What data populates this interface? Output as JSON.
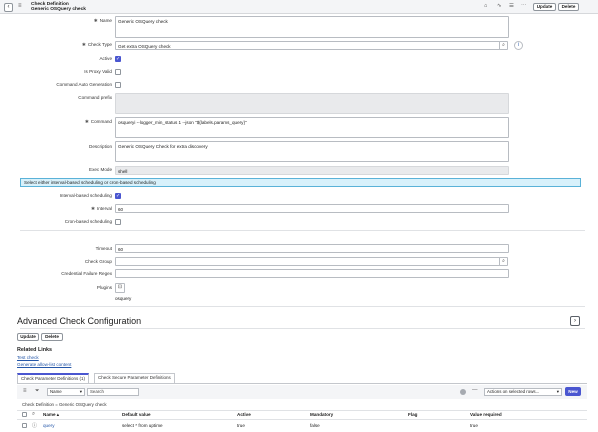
{
  "header": {
    "title_line1": "Check Definition",
    "title_line2": "Generic OSQuery check",
    "back_icon": "chevron-left-icon",
    "menu_icon": "hamburger-icon",
    "update_label": "Update",
    "delete_label": "Delete"
  },
  "form": {
    "name_label": "Name",
    "name_value": "Generic OSQuery check",
    "check_type_label": "Check Type",
    "check_type_value": "Get extra OSQuery check",
    "active_label": "Active",
    "proxy_label": "Is Proxy Valid",
    "auto_gen_label": "Command Auto Generation",
    "prefix_label": "Command prefix",
    "command_label": "Command",
    "command_value": "osqueryi --logger_min_status 1 --json \"${labels.params_query}\"",
    "description_label": "Description",
    "description_value": "Generic OSQuery Check for extra discovery",
    "exec_mode_label": "Exec Mode",
    "exec_mode_value": "shell",
    "info_message": "Select either interval-based scheduling or cron-based scheduling",
    "interval_sched_label": "Interval-based scheduling",
    "interval_label": "Interval",
    "interval_value": "60",
    "cron_label": "Cron-based scheduling",
    "timeout_label": "Timeout",
    "timeout_value": "60",
    "check_group_label": "Check Group",
    "cred_regex_label": "Credential Failure Regex",
    "plugins_label": "Plugins",
    "plugins_value": "osquery"
  },
  "advanced": {
    "title": "Advanced Check Configuration",
    "update_label": "Update",
    "delete_label": "Delete",
    "related_links_title": "Related Links",
    "link_test": "Test check",
    "link_allow": "Generate allow-list content"
  },
  "tabs": [
    {
      "label": "Check Parameter Definitions (1)"
    },
    {
      "label": "Check Secure Parameter Definitions"
    }
  ],
  "list": {
    "filter_field": "Name",
    "search_placeholder": "Search",
    "actions_label": "Actions on selected rows...",
    "new_label": "New",
    "breadcrumb": "Check Definition = Generic OSQuery check",
    "columns": [
      "Name",
      "Default value",
      "Active",
      "Mandatory",
      "Flag",
      "Value required"
    ],
    "rows": [
      {
        "name": "query",
        "default": "select * from uptime",
        "active": "true",
        "mandatory": "false",
        "flag": "",
        "required": "true"
      }
    ]
  },
  "colors": {
    "accent": "#4a56d0",
    "info_bg": "#d8f1fb",
    "link": "#2456a8"
  }
}
